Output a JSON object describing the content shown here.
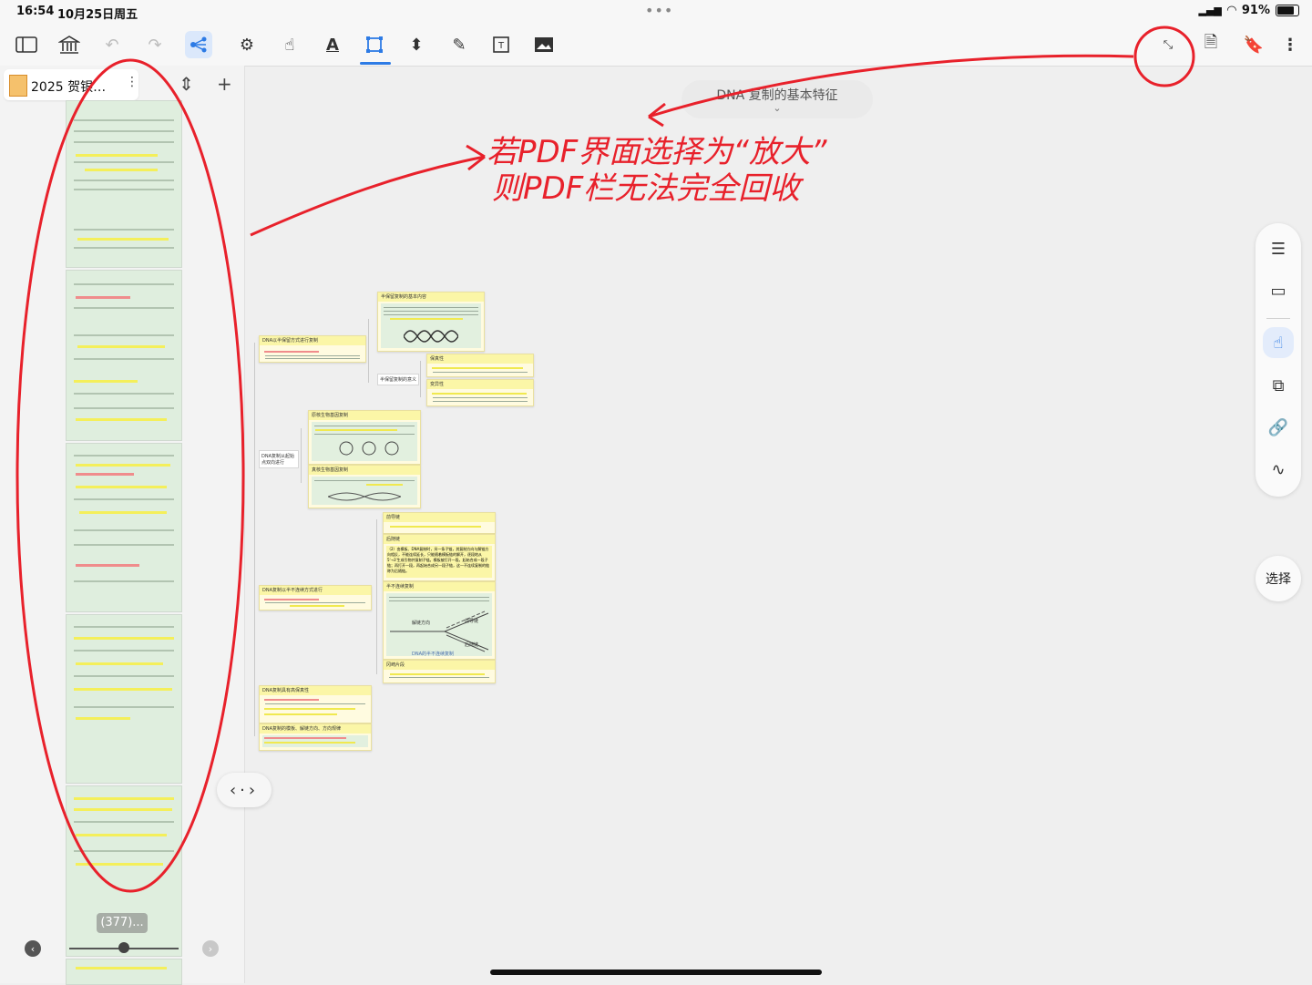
{
  "status_bar": {
    "time": "16:54",
    "date": "10月25日周五",
    "battery": "91%"
  },
  "toolbar": {
    "tools": [
      "sidebar-icon",
      "library-icon",
      "undo-icon",
      "redo-icon",
      "mindmap-icon",
      "settings-icon",
      "hand-icon",
      "text-format-icon",
      "crop-icon",
      "transform-icon",
      "pen-icon",
      "textbox-icon",
      "image-icon"
    ],
    "right_tools": [
      "collapse-icon",
      "search-doc-icon",
      "bookmark-icon",
      "more-icon"
    ],
    "accent": "#2d7be5"
  },
  "sidebar": {
    "doc_title": "2025 贺银…",
    "page_count": "(377)..."
  },
  "canvas": {
    "topic_title": "DNA 复制的基本特征",
    "nodes": {
      "root1": "DNA以半保留方式进行复制",
      "n_semi": "半保留复制的基本内容",
      "n_semi_meaning": "半保留复制的意义",
      "n_stable": "保真性",
      "n_variant": "变异性",
      "root2": "DNA复制从起始点双向进行",
      "n_prok": "原核生物基因复制",
      "n_euk": "真核生物基因复制",
      "n_leading": "前导链",
      "n_lagging": "后随链",
      "n_okazaki": "半不连续复制",
      "n_okazaki2": "冈崎片段",
      "root3": "DNA复制以半不连续方式进行",
      "root4": "DNA复制具有高保真性",
      "root5": "DNA复制的模板、解链方向、方向规律",
      "diag_label_unwind": "解链方向",
      "diag_label_leading": "前导链",
      "diag_label_lagging": "后随链",
      "diag_caption": "DNA的半不连续复制",
      "node_lagging_text": "（2）由模板、DNA复制时，另一条子链，其复制方向与解链方向相反，不能连续延长，只能随着模板链的解开，逐段地从5'→3'生成引物并复制子链。模板被打开一段，起始合成一段子链；再打开一段，再起始合成另一段子链，这一不连续复制的链称为后随链。"
    }
  },
  "right_panel": {
    "tools": [
      "list-icon",
      "layout-icon",
      "pointer-icon",
      "copy-icon",
      "link-icon",
      "scribble-icon"
    ],
    "select_label": "选择"
  },
  "annotation": {
    "handwritten_text_line1": "若PDF界面选择为“放大”",
    "handwritten_text_line2": "则PDF栏无法完全回收",
    "color": "#e8212b"
  }
}
